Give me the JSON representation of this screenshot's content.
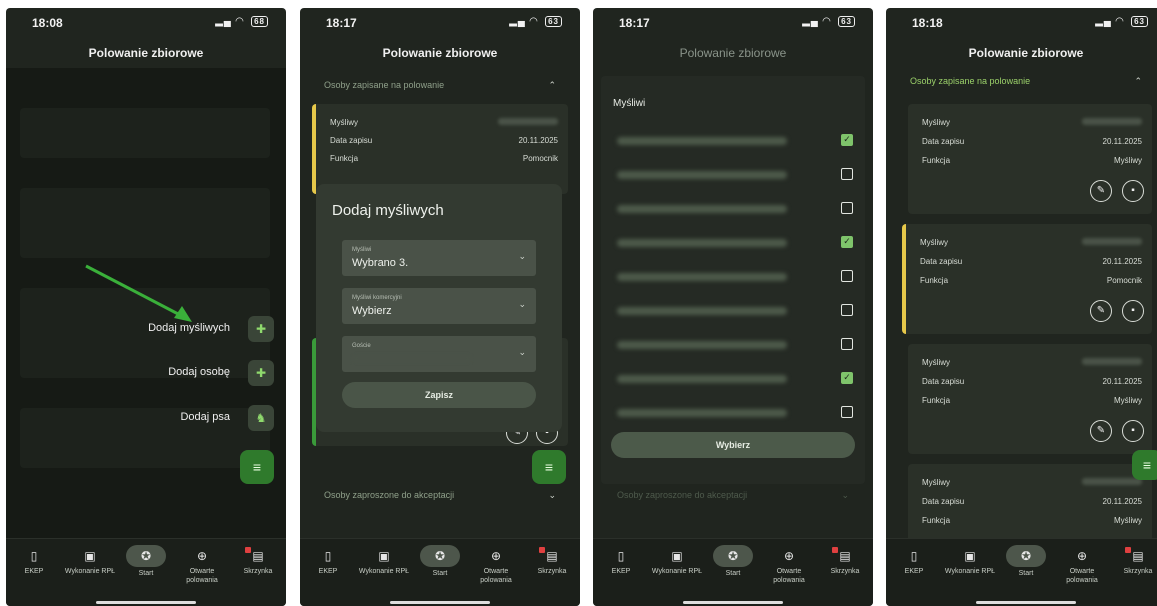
{
  "screen_title": "Polowanie zbiorowe",
  "phones": [
    {
      "time": "18:08",
      "battery": "68"
    },
    {
      "time": "18:17",
      "battery": "63"
    },
    {
      "time": "18:17",
      "battery": "63"
    },
    {
      "time": "18:18",
      "battery": "63"
    }
  ],
  "nav": {
    "ekep": "EKEP",
    "wykonanie": "Wykonanie RPŁ",
    "start": "Start",
    "otwarte": "Otwarte polowania",
    "skrzynka": "Skrzynka"
  },
  "fab_menu": {
    "add_hunters": "Dodaj myśliwych",
    "add_person": "Dodaj osobę",
    "add_dog": "Dodaj psa"
  },
  "sections": {
    "registered": "Osoby zapisane na polowanie",
    "invited": "Osoby zaproszone do akceptacji"
  },
  "card_labels": {
    "hunter": "Myśliwy",
    "date": "Data zapisu",
    "function": "Funkcja"
  },
  "cards": [
    {
      "date": "20.11.2025",
      "function": "Pomocnik"
    }
  ],
  "dialog": {
    "title": "Dodaj myśliwych",
    "field1_label": "Myśliwi",
    "field1_value": "Wybrano 3.",
    "field2_label": "Myśliwi komercyjni",
    "field2_value": "Wybierz",
    "field3_label": "Goście",
    "save": "Zapisz"
  },
  "picker": {
    "header": "Myśliwi",
    "checked": [
      true,
      false,
      false,
      true,
      false,
      false,
      false,
      true,
      false
    ],
    "select_button": "Wybierz"
  },
  "phone4_cards": [
    {
      "date": "20.11.2025",
      "function": "Myśliwy"
    },
    {
      "date": "20.11.2025",
      "function": "Pomocnik"
    },
    {
      "date": "20.11.2025",
      "function": "Myśliwy"
    },
    {
      "date": "20.11.2025",
      "function": "Myśliwy"
    }
  ],
  "colors": {
    "background": "#20251f",
    "accent_green": "#2f7a2c",
    "accent_yellow": "#e6c84a",
    "check_green": "#7fc46b"
  }
}
